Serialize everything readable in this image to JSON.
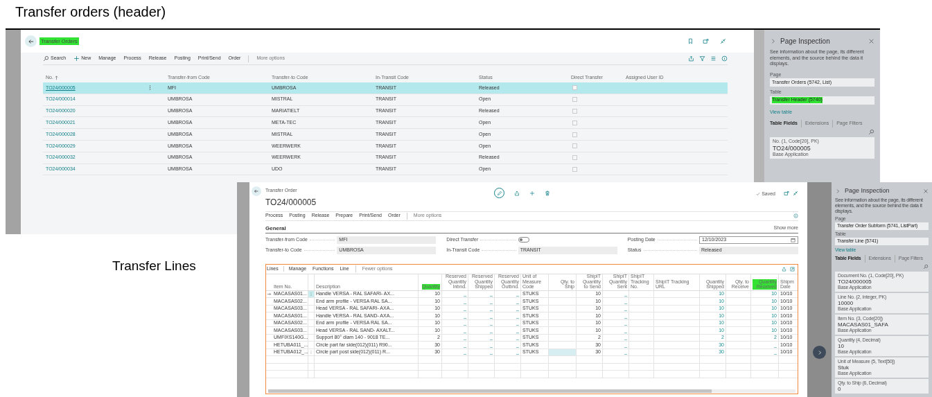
{
  "captions": [
    {
      "text": "Transfer orders (header)"
    },
    {
      "text": "Transfer Lines"
    }
  ],
  "list_window": {
    "title": {
      "text": "Transfer Orders",
      "highlighted": true
    },
    "actions": [
      {
        "label": "Search",
        "kind": "search"
      },
      {
        "label": "New",
        "kind": "new"
      },
      {
        "label": "Manage",
        "kind": "plain"
      },
      {
        "label": "Process",
        "kind": "plain"
      },
      {
        "label": "Release",
        "kind": "plain"
      },
      {
        "label": "Posting",
        "kind": "plain"
      },
      {
        "label": "Print/Send",
        "kind": "plain"
      },
      {
        "label": "Order",
        "kind": "plain"
      },
      {
        "label": "More options",
        "kind": "more"
      }
    ],
    "columns": [
      {
        "label": "No.",
        "sorted": true
      },
      {
        "label": "Transfer-from Code",
        "sorted": false
      },
      {
        "label": "Transfer-to Code",
        "sorted": false
      },
      {
        "label": "In-Transit Code",
        "sorted": false
      },
      {
        "label": "Status",
        "sorted": false
      },
      {
        "label": "Direct Transfer",
        "sorted": false
      },
      {
        "label": "Assigned User ID",
        "sorted": false
      }
    ],
    "rows": [
      {
        "cells": [
          "TO24/000005",
          "MFI",
          "UMBROSA",
          "TRANSIT",
          "Released"
        ],
        "direct_transfer": false,
        "selected": true
      },
      {
        "cells": [
          "TO24/000014",
          "UMBROSA",
          "MISTRAL",
          "TRANSIT",
          "Open"
        ],
        "direct_transfer": false,
        "selected": false
      },
      {
        "cells": [
          "TO24/000020",
          "UMBROSA",
          "MARIATIELT",
          "TRANSIT",
          "Released"
        ],
        "direct_transfer": false,
        "selected": false
      },
      {
        "cells": [
          "TO24/000021",
          "UMBROSA",
          "META-TEC",
          "TRANSIT",
          "Open"
        ],
        "direct_transfer": false,
        "selected": false
      },
      {
        "cells": [
          "TO24/000028",
          "UMBROSA",
          "MISTRAL",
          "TRANSIT",
          "Open"
        ],
        "direct_transfer": false,
        "selected": false
      },
      {
        "cells": [
          "TO24/000029",
          "UMBROSA",
          "WEERWERK",
          "TRANSIT",
          "Open"
        ],
        "direct_transfer": false,
        "selected": false
      },
      {
        "cells": [
          "TO24/000032",
          "UMBROSA",
          "WEERWERK",
          "TRANSIT",
          "Released"
        ],
        "direct_transfer": false,
        "selected": false
      },
      {
        "cells": [
          "TO24/000034",
          "UMBROSA",
          "UDO",
          "TRANSIT",
          "Open"
        ],
        "direct_transfer": false,
        "selected": false
      }
    ],
    "inspection": {
      "title": "Page Inspection",
      "description": "See information about the page, its different elements, and the source behind the data it displays.",
      "page_label": "Page",
      "page_value": "Transfer Orders (5742, List)",
      "table_label": "Table",
      "table_value": {
        "text": "Transfer Header (5740)",
        "highlighted": true
      },
      "link": "View table",
      "tabs": [
        {
          "label": "Table Fields",
          "selected": true
        },
        {
          "label": "Extensions",
          "selected": false
        },
        {
          "label": "Page Filters",
          "selected": false
        }
      ],
      "fields": [
        {
          "name": "No. (1, Code[20], PK)",
          "value": "TO24/000005",
          "source": "Base Application"
        }
      ]
    }
  },
  "card_window": {
    "caption": "Transfer Order",
    "title": "TO24/000005",
    "saved": "Saved",
    "actions": [
      {
        "label": "Process",
        "kind": "plain"
      },
      {
        "label": "Posting",
        "kind": "plain"
      },
      {
        "label": "Release",
        "kind": "plain"
      },
      {
        "label": "Prepare",
        "kind": "plain"
      },
      {
        "label": "Print/Send",
        "kind": "plain"
      },
      {
        "label": "Order",
        "kind": "plain"
      },
      {
        "label": "More options",
        "kind": "more"
      }
    ],
    "section": {
      "title": "General",
      "show_more": "Show more"
    },
    "fields": [
      {
        "label": "Transfer-from Code",
        "kind": "text",
        "value": "MFI"
      },
      {
        "label": "Direct Transfer",
        "kind": "toggle",
        "on": false
      },
      {
        "label": "Posting Date",
        "kind": "date",
        "value": "12/10/2023"
      },
      {
        "label": "Transfer-to Code",
        "kind": "text",
        "value": "UMBROSA"
      },
      {
        "label": "In-Transit Code",
        "kind": "text",
        "value": "TRANSIT"
      },
      {
        "label": "Status",
        "kind": "text",
        "value": "Released"
      }
    ],
    "lines": {
      "title": "Lines",
      "actions": [
        {
          "label": "Manage",
          "kind": "plain"
        },
        {
          "label": "Functions",
          "kind": "plain"
        },
        {
          "label": "Line",
          "kind": "plain"
        },
        {
          "label": "Fewer options",
          "kind": "more"
        }
      ],
      "columns": [
        {
          "label": "Item No.",
          "kind": "text",
          "highlighted": false
        },
        {
          "label": "Description",
          "kind": "text",
          "highlighted": false
        },
        {
          "label": "Quantity",
          "kind": "number",
          "highlighted": true
        },
        {
          "label": "Reserved Quantity Inbnd.",
          "kind": "drilldown",
          "highlighted": false
        },
        {
          "label": "Reserved Quantity Shipped",
          "kind": "drilldown",
          "highlighted": false
        },
        {
          "label": "Reserved Quantity Outbnd.",
          "kind": "drilldown",
          "highlighted": false
        },
        {
          "label": "Unit of Measure Code",
          "kind": "text",
          "highlighted": false
        },
        {
          "label": "Qty. to Ship",
          "kind": "number",
          "highlighted": false
        },
        {
          "label": "ShipIT Quantity to Send",
          "kind": "number",
          "highlighted": false
        },
        {
          "label": "ShipIT Quantity Sent",
          "kind": "drilldown",
          "highlighted": false
        },
        {
          "label": "ShipIT Tracking No.",
          "kind": "text",
          "highlighted": false
        },
        {
          "label": "ShipIT Tracking URL",
          "kind": "text",
          "highlighted": false
        },
        {
          "label": "Quantity Shipped",
          "kind": "drilldown",
          "highlighted": false
        },
        {
          "label": "Qty. to Receive",
          "kind": "number",
          "highlighted": false
        },
        {
          "label": "Quantity Received",
          "kind": "drilldown",
          "highlighted": true
        },
        {
          "label": "Shipm Date",
          "kind": "text",
          "highlighted": false
        }
      ],
      "rows": [
        {
          "current": true,
          "selected": false,
          "cells": [
            "MACASAS01...",
            "Handle VERSA - RAL SAFARI- AX...",
            "10",
            "_",
            "_",
            "_",
            "STUKS",
            null,
            "10",
            "_",
            null,
            null,
            "10",
            null,
            "10",
            "10/10"
          ]
        },
        {
          "current": false,
          "selected": false,
          "cells": [
            "MACASAS02...",
            "End arm profile - VERSA RAL SA...",
            "10",
            "_",
            "_",
            "_",
            "STUKS",
            null,
            "10",
            "_",
            null,
            null,
            "10",
            null,
            "10",
            "10/10"
          ]
        },
        {
          "current": false,
          "selected": false,
          "cells": [
            "MACASAS03...",
            "Head VERSA - RAL SAFARI- AXA...",
            "10",
            "_",
            "_",
            "_",
            "STUKS",
            null,
            "10",
            "_",
            null,
            null,
            "10",
            null,
            "10",
            "10/10"
          ]
        },
        {
          "current": false,
          "selected": false,
          "cells": [
            "MACASAS01...",
            "Handle VERSA - RAL SAND- AXA...",
            "10",
            "_",
            "_",
            "_",
            "STUKS",
            null,
            "10",
            "_",
            null,
            null,
            "10",
            null,
            "10",
            "10/10"
          ]
        },
        {
          "current": false,
          "selected": false,
          "cells": [
            "MACASAS02...",
            "End arm profile - VERSA RAL SA...",
            "10",
            "_",
            "_",
            "_",
            "STUKS",
            null,
            "10",
            "_",
            null,
            null,
            "10",
            null,
            "10",
            "10/10"
          ]
        },
        {
          "current": false,
          "selected": false,
          "cells": [
            "MACASAS03...",
            "Head VERSA - RAL SAND- AXALT...",
            "10",
            "_",
            "_",
            "_",
            "STUKS",
            null,
            "10",
            "_",
            null,
            null,
            "10",
            null,
            "10",
            "10/10"
          ]
        },
        {
          "current": false,
          "selected": false,
          "cells": [
            "UMFIXS140G...",
            "Support 80° diam 140 - 9018 TE...",
            "2",
            "_",
            "_",
            "_",
            "STUKS",
            null,
            "2",
            "_",
            null,
            null,
            "2",
            null,
            "2",
            "10/10"
          ]
        },
        {
          "current": false,
          "selected": false,
          "cells": [
            "HETUBA011_...",
            "Circle part far side(012)(011) R90...",
            "30",
            "_",
            "_",
            "_",
            "STUKS",
            null,
            "30",
            "_",
            null,
            null,
            "30",
            null,
            "_",
            "10/10"
          ]
        },
        {
          "current": false,
          "selected": true,
          "cells": [
            "HETUBA012_...",
            "Circle part post side(012)(011) R...",
            "30",
            "_",
            "_",
            "_",
            "STUKS",
            null,
            "30",
            "_",
            null,
            null,
            "30",
            null,
            "_",
            "10/10"
          ]
        }
      ]
    },
    "inspection": {
      "title": "Page Inspection",
      "description": "See information about the page, its different elements, and the source behind the data it displays.",
      "page_label": "Page",
      "page_value": "Transfer Order Subform (5741, ListPart)",
      "table_label": "Table",
      "table_value": {
        "text": "Transfer Line (5741)",
        "highlighted": false
      },
      "link": "View table",
      "tabs": [
        {
          "label": "Table Fields",
          "selected": true
        },
        {
          "label": "Extensions",
          "selected": false
        },
        {
          "label": "Page Filters",
          "selected": false
        }
      ],
      "fields": [
        {
          "name": "Document No. (1, Code[20], PK)",
          "value": "TO24/000005",
          "source": "Base Application"
        },
        {
          "name": "Line No. (2, Integer, PK)",
          "value": "10000",
          "source": "Base Application"
        },
        {
          "name": "Item No. (3, Code[20])",
          "value": "MACASAS01_SAFA",
          "source": "Base Application"
        },
        {
          "name": "Quantity (4, Decimal)",
          "value": "10",
          "source": "Base Application"
        },
        {
          "name": "Unit of Measure (5, Text[50])",
          "value": "Stuk",
          "source": "Base Application"
        },
        {
          "name": "Qty. to Ship (6, Decimal)",
          "value": "0"
        }
      ]
    }
  }
}
